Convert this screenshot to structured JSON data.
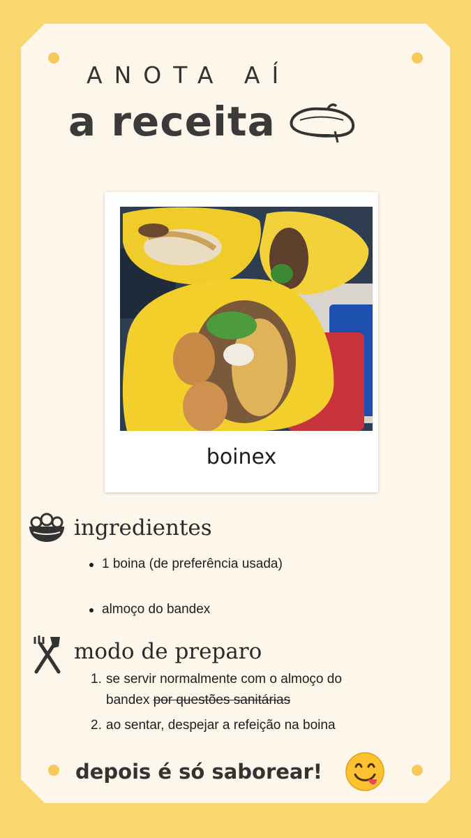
{
  "header": {
    "line1": "ANOTA AÍ",
    "line2": "a receita",
    "icon": "beret-icon"
  },
  "polaroid": {
    "caption": "boinex"
  },
  "ingredients": {
    "title": "ingredientes",
    "icon": "salad-bowl-icon",
    "items": [
      "1 boina (de preferência usada)",
      "almoço do bandex"
    ]
  },
  "preparation": {
    "title": "modo de preparo",
    "icon": "fork-knife-icon",
    "steps": [
      {
        "number": "1.",
        "text": "se servir normalmente com o almoço do",
        "text_cont": "bandex",
        "strikethrough": "por questões sanitárias"
      },
      {
        "number": "2.",
        "text": "ao sentar, despejar a refeição na boina"
      }
    ]
  },
  "footer": {
    "text": "depois é só saborear!",
    "emoji": "yum-face-emoji"
  },
  "colors": {
    "background": "#fbd56e",
    "card": "#fdf6ea",
    "dot": "#f7c95a",
    "text": "#333333"
  }
}
